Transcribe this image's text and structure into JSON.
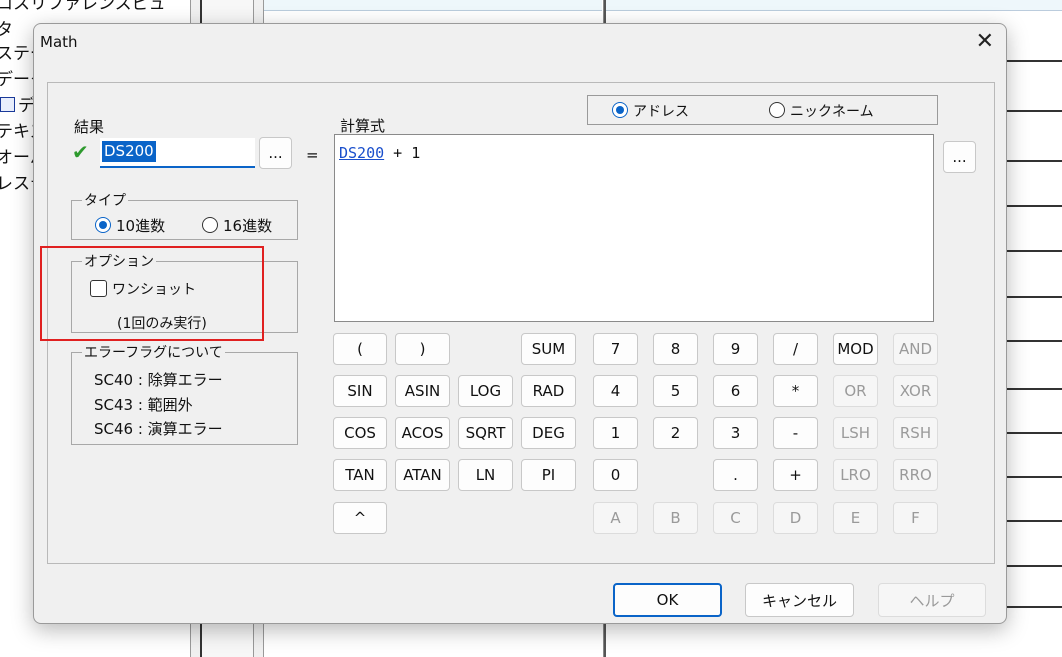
{
  "background": {
    "tree_lines": [
      "ロスリファレンスビュ",
      "タ",
      "ステー",
      "データ",
      "デ",
      "テキス",
      "オーバ",
      "レステ"
    ]
  },
  "dialog": {
    "title": "Math",
    "result": {
      "label": "結果",
      "value": "DS200",
      "browse_label": "..."
    },
    "equals": "=",
    "address_mode": {
      "options": [
        {
          "label": "アドレス",
          "selected": true
        },
        {
          "label": "ニックネーム",
          "selected": false
        }
      ]
    },
    "formula": {
      "label": "計算式",
      "operand_link": "DS200",
      "rest": " + 1",
      "browse_label": "..."
    },
    "type_group": {
      "legend": "タイプ",
      "options": [
        {
          "label": "10進数",
          "selected": true
        },
        {
          "label": "16進数",
          "selected": false
        }
      ]
    },
    "options_group": {
      "legend": "オプション",
      "oneshot_label": "ワンショット",
      "oneshot_checked": false,
      "note": "(1回のみ実行)"
    },
    "error_group": {
      "legend": "エラーフラグについて",
      "lines": [
        "SC40 : 除算エラー",
        "SC43 : 範囲外",
        "SC46 : 演算エラー"
      ]
    },
    "keypad": {
      "functions": [
        [
          "(",
          ")",
          "",
          "SUM"
        ],
        [
          "SIN",
          "ASIN",
          "LOG",
          "RAD"
        ],
        [
          "COS",
          "ACOS",
          "SQRT",
          "DEG"
        ],
        [
          "TAN",
          "ATAN",
          "LN",
          "PI"
        ],
        [
          "^",
          "",
          "",
          ""
        ]
      ],
      "digits": [
        [
          "7",
          "8",
          "9",
          "/",
          "MOD",
          "AND"
        ],
        [
          "4",
          "5",
          "6",
          "*",
          "OR",
          "XOR"
        ],
        [
          "1",
          "2",
          "3",
          "-",
          "LSH",
          "RSH"
        ],
        [
          "0",
          "",
          ".",
          "+",
          "LRO",
          "RRO"
        ],
        [
          "A",
          "B",
          "C",
          "D",
          "E",
          "F"
        ]
      ],
      "disabled": [
        "AND",
        "OR",
        "XOR",
        "LSH",
        "RSH",
        "LRO",
        "RRO",
        "A",
        "B",
        "C",
        "D",
        "E",
        "F"
      ]
    },
    "footer": {
      "ok_label": "OK",
      "cancel_label": "キャンセル",
      "help_label": "ヘルプ"
    }
  }
}
